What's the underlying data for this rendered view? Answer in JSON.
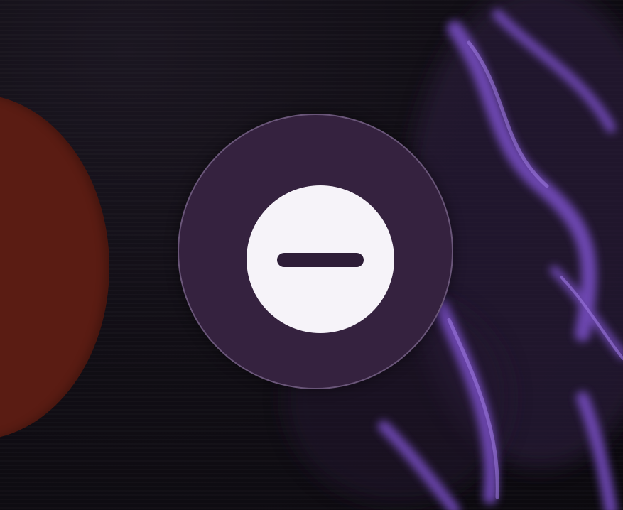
{
  "screen": {
    "background_color": "#0c0a10",
    "artwork_tint": "#7a4fc8"
  },
  "side_avatar": {
    "color": "#5a1c13"
  },
  "remove_button": {
    "icon": "minus-circle-icon",
    "ring_color": "#35223f",
    "disc_color": "#f6f3f9",
    "bar_color": "#2e1d38"
  }
}
